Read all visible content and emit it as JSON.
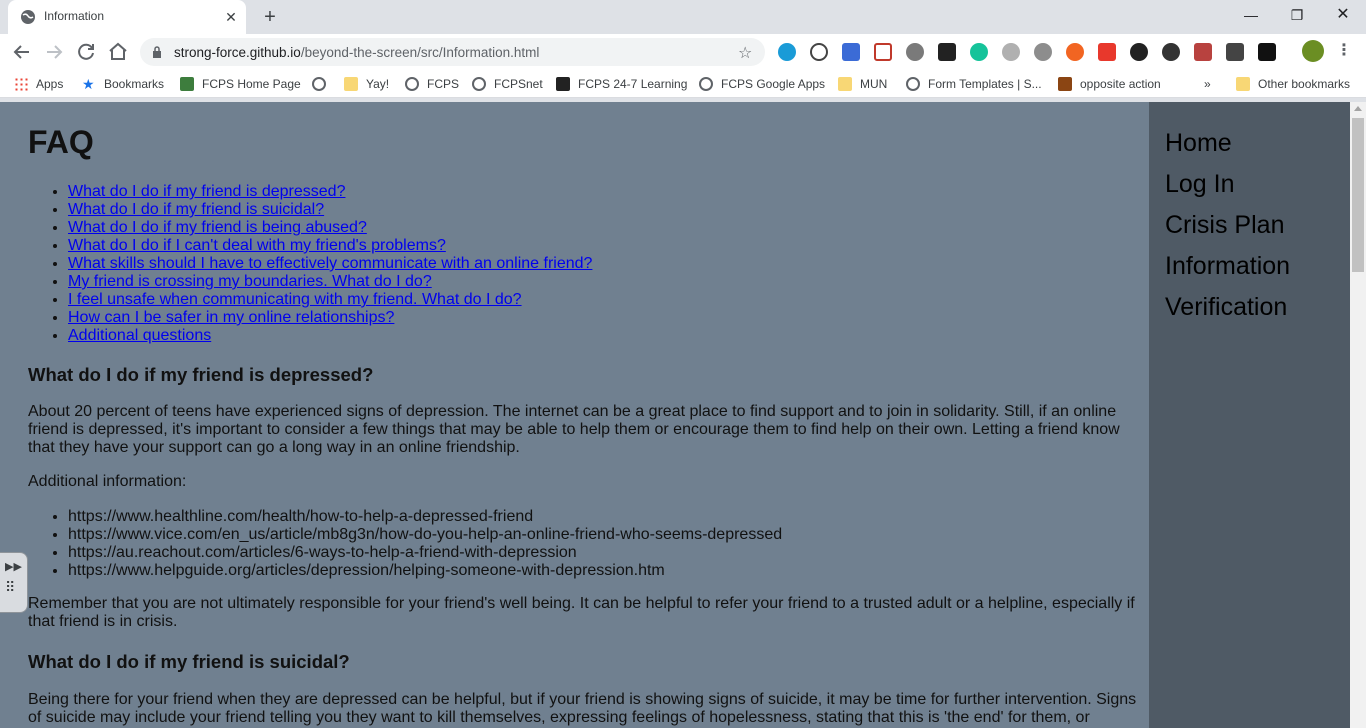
{
  "browser": {
    "tab_title": "Information",
    "tab_close": "✕",
    "new_tab": "+",
    "minimize": "—",
    "restore": "❐",
    "close": "✕",
    "url_host": "strong-force.github.io",
    "url_path": "/beyond-the-screen/src/Information.html",
    "bookmarks": [
      {
        "label": "Apps",
        "icon": "apps-grid-icon"
      },
      {
        "label": "Bookmarks",
        "icon": "star-icon"
      },
      {
        "label": "FCPS Home Page",
        "icon": "fcps-logo-icon"
      },
      {
        "label": "",
        "icon": "globe-icon"
      },
      {
        "label": "Yay!",
        "icon": "folder-icon"
      },
      {
        "label": "FCPS",
        "icon": "globe-icon"
      },
      {
        "label": "FCPSnet",
        "icon": "globe-icon"
      },
      {
        "label": "FCPS 24-7 Learning",
        "icon": "blackboard-icon"
      },
      {
        "label": "FCPS Google Apps",
        "icon": "globe-icon"
      },
      {
        "label": "MUN",
        "icon": "folder-icon"
      },
      {
        "label": "Form Templates | S...",
        "icon": "globe-icon"
      },
      {
        "label": "opposite action",
        "icon": "site-favicon-icon"
      },
      {
        "label": "»",
        "icon": ""
      },
      {
        "label": "Other bookmarks",
        "icon": "folder-icon"
      }
    ]
  },
  "page": {
    "heading": "FAQ",
    "faq_links": [
      "What do I do if my friend is depressed?",
      "What do I do if my friend is suicidal?",
      "What do I do if my friend is being abused?",
      "What do I do if I can't deal with my friend's problems?",
      "What skills should I have to effectively communicate with an online friend?",
      "My friend is crossing my boundaries. What do I do?",
      "I feel unsafe when communicating with my friend. What do I do?",
      "How can I be safer in my online relationships?",
      "Additional questions"
    ],
    "section1_title": "What do I do if my friend is depressed?",
    "section1_body": "About 20 percent of teens have experienced signs of depression. The internet can be a great place to find support and to join in solidarity. Still, if an online friend is depressed, it's important to consider a few things that may be able to help them or encourage them to find help on their own. Letting a friend know that they have your support can go a long way in an online friendship.",
    "additional_info_label": "Additional information:",
    "resource_links": [
      "https://www.healthline.com/health/how-to-help-a-depressed-friend",
      "https://www.vice.com/en_us/article/mb8g3n/how-do-you-help-an-online-friend-who-seems-depressed",
      "https://au.reachout.com/articles/6-ways-to-help-a-friend-with-depression",
      "https://www.helpguide.org/articles/depression/helping-someone-with-depression.htm"
    ],
    "reminder": "Remember that you are not ultimately responsible for your friend's well being. It can be helpful to refer your friend to a trusted adult or a helpline, especially if that friend is in crisis.",
    "section2_title": "What do I do if my friend is suicidal?",
    "section2_body": "Being there for your friend when they are depressed can be helpful, but if your friend is showing signs of suicide, it may be time for further intervention. Signs of suicide may include your friend telling you they want to kill themselves, expressing feelings of hopelessness, stating that this is 'the end' for them, or"
  },
  "sidebar": {
    "nav": [
      "Home",
      "Log In",
      "Crisis Plan",
      "Information",
      "Verification"
    ]
  }
}
